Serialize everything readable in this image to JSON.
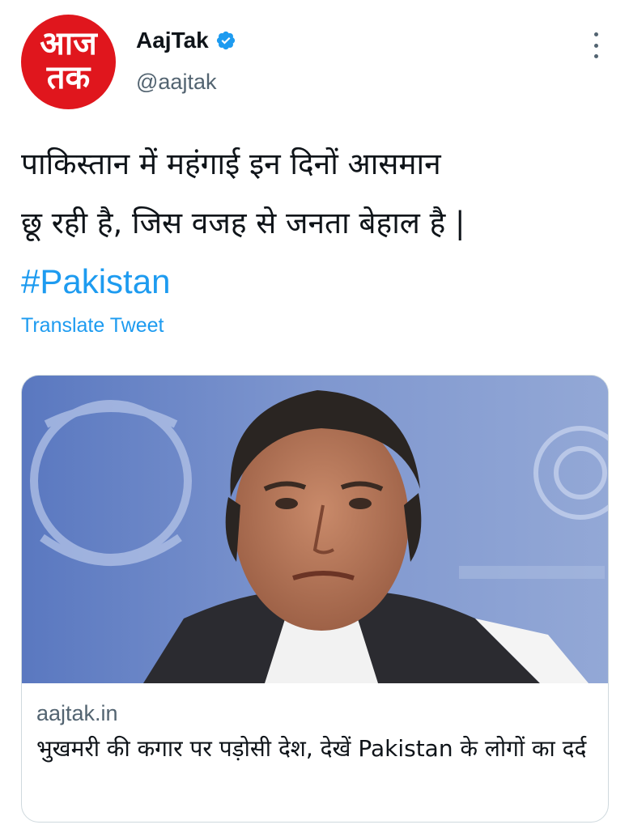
{
  "account": {
    "avatar_line1": "आज",
    "avatar_line2": "तक",
    "display_name": "AajTak",
    "handle": "@aajtak"
  },
  "tweet": {
    "text_line1": "पाकिस्तान में महंगाई इन दिनों आसमान",
    "text_line2": "छू रही है, जिस वजह से जनता बेहाल है |",
    "hashtag": "#Pakistan",
    "translate_label": "Translate Tweet"
  },
  "card": {
    "domain": "aajtak.in",
    "title": "भुखमरी की कगार पर पड़ोसी देश, देखें Pakistan के लोगों का दर्द"
  },
  "colors": {
    "brand_red": "#e0161d",
    "link_blue": "#1d9bf0",
    "secondary_text": "#536471",
    "un_background_blue": "#6b86c4"
  },
  "icons": {
    "verified": "verified-badge-icon",
    "more": "more-options-icon"
  }
}
